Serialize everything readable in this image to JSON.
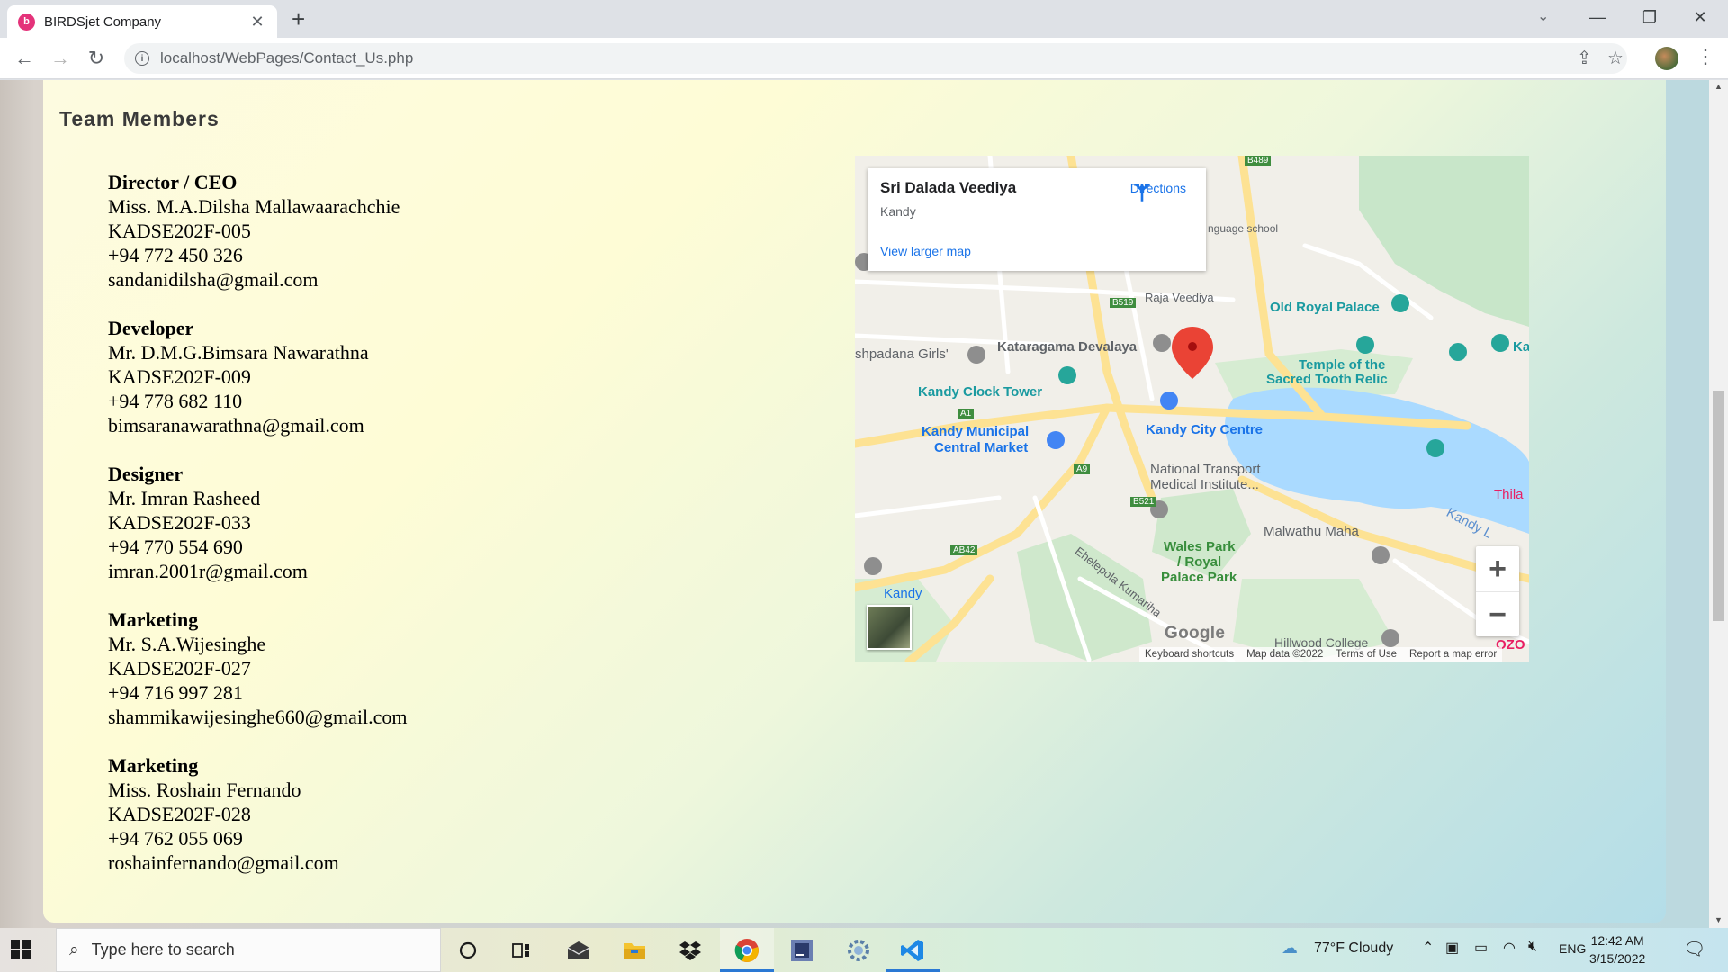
{
  "browser": {
    "tab_title": "BIRDSjet Company",
    "favicon_glyph": "b",
    "url": "localhost/WebPages/Contact_Us.php"
  },
  "page": {
    "section_title": "Team Members",
    "members": [
      {
        "role": "Director / CEO",
        "name": "Miss. M.A.Dilsha Mallawaarachchie",
        "id": "KADSE202F-005",
        "phone": "+94 772 450 326",
        "email": "sandanidilsha@gmail.com"
      },
      {
        "role": "Developer",
        "name": "Mr. D.M.G.Bimsara Nawarathna",
        "id": "KADSE202F-009",
        "phone": "+94 778 682 110",
        "email": "bimsaranawarathna@gmail.com"
      },
      {
        "role": "Designer",
        "name": "Mr. Imran Rasheed",
        "id": "KADSE202F-033",
        "phone": "+94 770 554 690",
        "email": "imran.2001r@gmail.com"
      },
      {
        "role": "Marketing",
        "name": "Mr. S.A.Wijesinghe",
        "id": "KADSE202F-027",
        "phone": "+94 716 997 281",
        "email": "shammikawijesinghe660@gmail.com"
      },
      {
        "role": "Marketing",
        "name": "Miss. Roshain Fernando",
        "id": "KADSE202F-028",
        "phone": "+94 762 055 069",
        "email": "roshainfernando@gmail.com"
      }
    ]
  },
  "map": {
    "place_name": "Sri Dalada Veediya",
    "place_area": "Kandy",
    "directions_label": "Directions",
    "larger_map_label": "View larger map",
    "google_logo": "Google",
    "attribution": [
      "Keyboard shortcuts",
      "Map data ©2022",
      "Terms of Use",
      "Report a map error"
    ],
    "labels": {
      "old_royal_palace": "Old Royal Palace",
      "temple_1": "Temple of the",
      "temple_2": "Sacred Tooth Relic",
      "kataragama": "Kataragama Devalaya",
      "clock_tower": "Kandy Clock Tower",
      "kandy_city_centre": "Kandy City Centre",
      "municipal_1": "Kandy Municipal",
      "municipal_2": "Central Market",
      "nti_1": "National Transport",
      "nti_2": "Medical Institute...",
      "malwathu": "Malwathu Maha",
      "wales_1": "Wales Park",
      "wales_2": "/ Royal",
      "wales_3": "Palace Park",
      "kandy": "Kandy",
      "raja_veediya": "Raja Veediya",
      "shpadana": "shpadana Girls'",
      "language_school": "nguage school",
      "thila": "Thila",
      "kandy_lake": "Kandy L",
      "ehelepola": "Ehelepola Kumariha",
      "hillwood": "Hillwood College",
      "ka": "Ka",
      "ozo": "OZO",
      "road_b519": "B519",
      "road_a1": "A1",
      "road_a9": "A9",
      "road_b521": "B521",
      "road_ab42": "AB42",
      "road_b489": "B489"
    }
  },
  "taskbar": {
    "search_placeholder": "Type here to search",
    "weather": "77°F  Cloudy",
    "lang": "ENG",
    "time": "12:42 AM",
    "date": "3/15/2022"
  }
}
